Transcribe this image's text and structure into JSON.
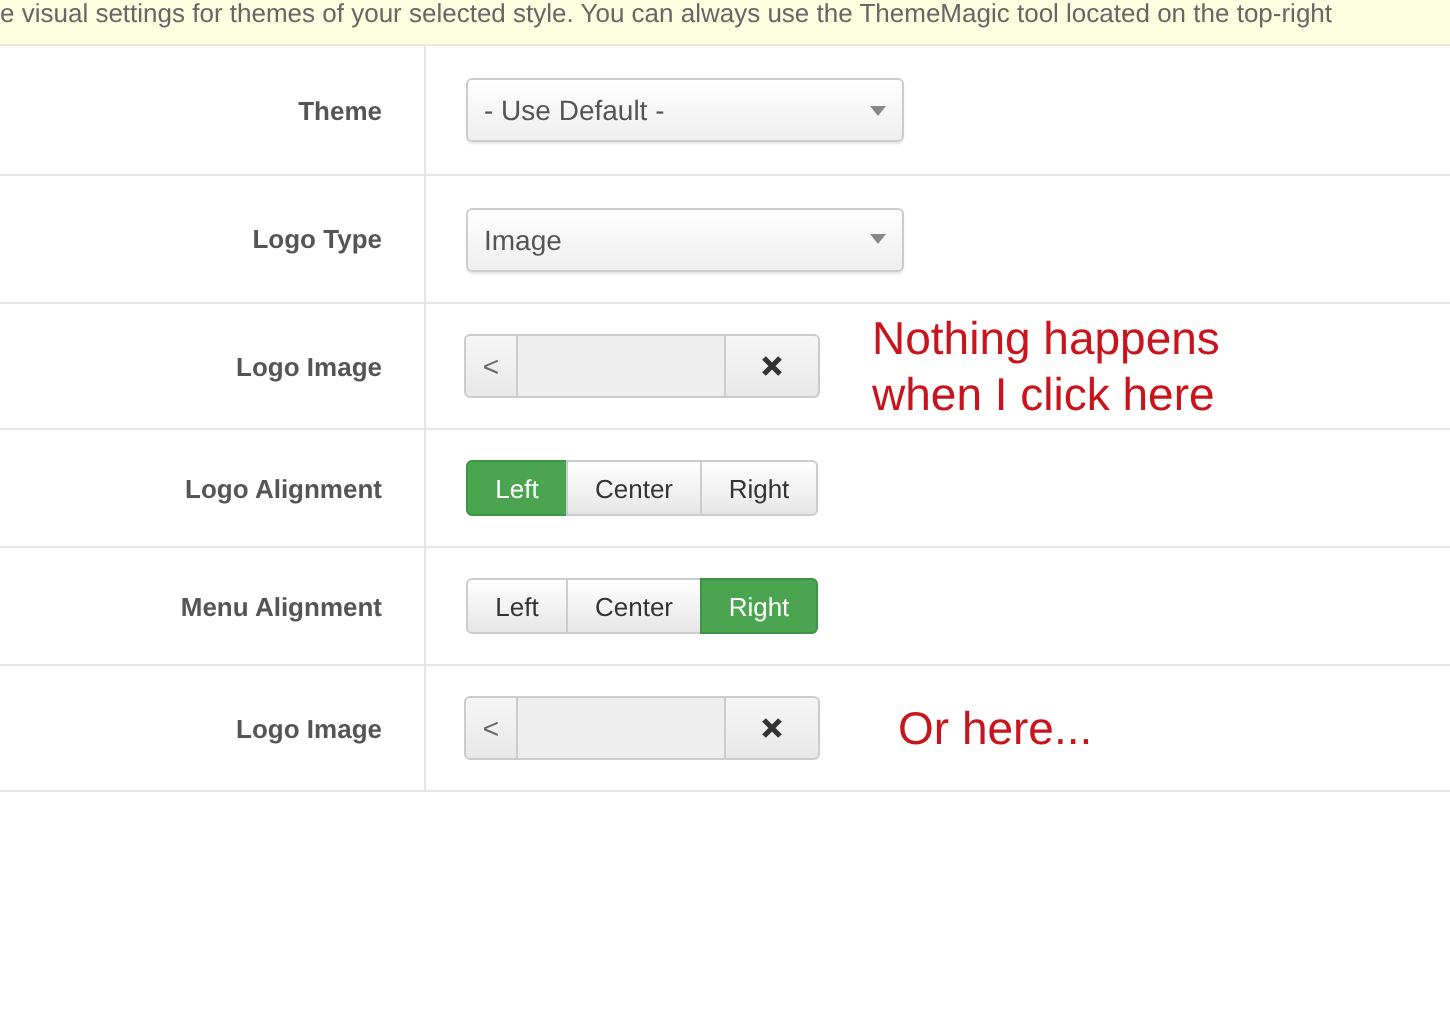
{
  "notice": "e visual settings for themes of your selected style. You can always use the ThemeMagic tool located on the top-right",
  "rows": [
    {
      "kind": "select",
      "label": "Theme",
      "value": "- Use Default -"
    },
    {
      "kind": "select",
      "label": "Logo Type",
      "value": "Image"
    },
    {
      "kind": "image",
      "label": "Logo Image",
      "prev": "<",
      "note": "Nothing happens when I click here"
    },
    {
      "kind": "buttons",
      "label": "Logo Alignment",
      "options": [
        {
          "label": "Left",
          "selected": true
        },
        {
          "label": "Center",
          "selected": false
        },
        {
          "label": "Right",
          "selected": false
        }
      ]
    },
    {
      "kind": "buttons",
      "label": "Menu Alignment",
      "options": [
        {
          "label": "Left",
          "selected": false
        },
        {
          "label": "Center",
          "selected": false
        },
        {
          "label": "Right",
          "selected": true
        }
      ]
    },
    {
      "kind": "image",
      "label": "Logo Image",
      "prev": "<",
      "note": "Or here..."
    }
  ]
}
